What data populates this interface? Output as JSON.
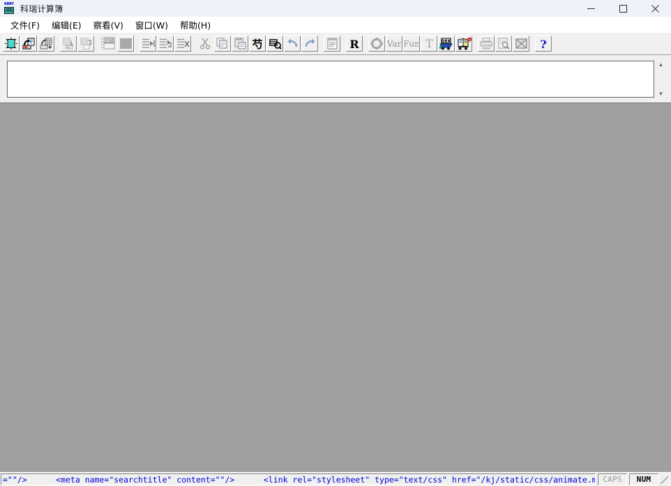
{
  "window": {
    "title": "科瑞计算簿",
    "app_icon": "calculator-keyboard-icon",
    "minimize_label": "minimize",
    "maximize_label": "maximize",
    "close_label": "close"
  },
  "menubar": {
    "items": [
      {
        "label": "文件(F)",
        "name": "menu-file"
      },
      {
        "label": "编辑(E)",
        "name": "menu-edit"
      },
      {
        "label": "察看(V)",
        "name": "menu-view"
      },
      {
        "label": "窗口(W)",
        "name": "menu-window"
      },
      {
        "label": "帮助(H)",
        "name": "menu-help"
      }
    ]
  },
  "toolbar": {
    "groups": [
      {
        "buttons": [
          {
            "icon": "new-document-icon",
            "enabled": true
          },
          {
            "icon": "open-document-icon",
            "enabled": true
          },
          {
            "icon": "open-template-icon",
            "enabled": true
          }
        ]
      },
      {
        "buttons": [
          {
            "icon": "save-document-icon",
            "enabled": false
          },
          {
            "icon": "save-as-icon",
            "enabled": false
          }
        ]
      },
      {
        "buttons": [
          {
            "icon": "ysb-icon",
            "enabled": false,
            "text": "YSB"
          },
          {
            "icon": "blank-page-icon",
            "enabled": false
          }
        ]
      },
      {
        "buttons": [
          {
            "icon": "insert-row-before-icon",
            "enabled": false
          },
          {
            "icon": "insert-row-after-icon",
            "enabled": false
          },
          {
            "icon": "delete-row-icon",
            "enabled": false
          }
        ]
      },
      {
        "buttons": [
          {
            "icon": "cut-icon",
            "enabled": false
          },
          {
            "icon": "copy-icon",
            "enabled": false
          },
          {
            "icon": "paste-icon",
            "enabled": false
          },
          {
            "icon": "chinese-char-icon",
            "enabled": true,
            "text": "芍"
          },
          {
            "icon": "find-replace-icon",
            "enabled": true
          },
          {
            "icon": "undo-icon",
            "enabled": false
          },
          {
            "icon": "redo-icon",
            "enabled": false
          }
        ]
      },
      {
        "buttons": [
          {
            "icon": "properties-icon",
            "enabled": false
          }
        ]
      },
      {
        "buttons": [
          {
            "icon": "bold-r-icon",
            "enabled": true,
            "text": "R"
          }
        ]
      },
      {
        "buttons": [
          {
            "icon": "settings-gear-icon",
            "enabled": false
          },
          {
            "icon": "variable-icon",
            "enabled": false,
            "text": "Var"
          },
          {
            "icon": "function-icon",
            "enabled": false,
            "text": "Fun"
          },
          {
            "icon": "text-icon",
            "enabled": false,
            "text": "T"
          },
          {
            "icon": "dek-cart-icon",
            "enabled": true,
            "text": "DEK"
          },
          {
            "icon": "book-cart-icon",
            "enabled": true
          }
        ]
      },
      {
        "buttons": [
          {
            "icon": "print-icon",
            "enabled": false
          },
          {
            "icon": "print-preview-icon",
            "enabled": false
          },
          {
            "icon": "export-image-icon",
            "enabled": false
          }
        ]
      },
      {
        "buttons": [
          {
            "icon": "help-question-icon",
            "enabled": true,
            "text": "?"
          }
        ]
      }
    ]
  },
  "document_pane": {
    "value": "",
    "placeholder": "",
    "scroll_up_icon": "scroll-up-arrow",
    "scroll_down_icon": "scroll-down-arrow"
  },
  "workspace": {
    "background_color": "#a0a0a0",
    "content": ""
  },
  "statusbar": {
    "message": "=\"\"/>      <meta name=\"searchtitle\" content=\"\"/>      <link rel=\"stylesheet\" type=\"text/css\" href=\"/kj/static/css/animate.min.css\"/>      <link rel=\"",
    "message_color": "#0000d7",
    "indicators": [
      {
        "label": "CAPS",
        "active": false,
        "name": "status-caps"
      },
      {
        "label": "NUM",
        "active": true,
        "name": "status-num"
      }
    ]
  }
}
